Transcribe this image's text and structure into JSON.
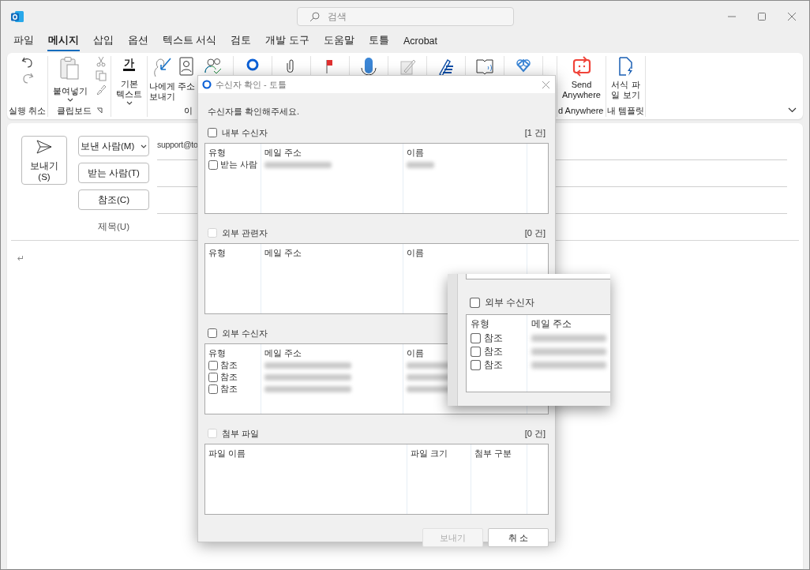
{
  "window": {
    "search_placeholder": "검색"
  },
  "tabs": [
    {
      "label": "파일",
      "selected": false
    },
    {
      "label": "메시지",
      "selected": true
    },
    {
      "label": "삽입",
      "selected": false
    },
    {
      "label": "옵션",
      "selected": false
    },
    {
      "label": "텍스트 서식",
      "selected": false
    },
    {
      "label": "검토",
      "selected": false
    },
    {
      "label": "개발 도구",
      "selected": false
    },
    {
      "label": "도움말",
      "selected": false
    },
    {
      "label": "토틀",
      "selected": false
    },
    {
      "label": "Acrobat",
      "selected": false
    }
  ],
  "ribbon": {
    "groups": [
      {
        "kind": "undo",
        "label": "실행 취소"
      },
      {
        "kind": "clipboard",
        "label": "클립보드",
        "buttons": [
          "붙여넣기"
        ]
      },
      {
        "kind": "text",
        "icon_text": "가",
        "buttons": [
          "기본 텍스트"
        ]
      },
      {
        "kind": "recipients",
        "label": "이",
        "buttons": [
          "나에게 보내기",
          "주소"
        ]
      },
      {
        "kind": "share",
        "label": "d Anywhere",
        "buttons": [
          "Send Anywhere"
        ]
      },
      {
        "kind": "template",
        "label": "내 템플릿",
        "buttons": [
          "서식 파일 보기"
        ]
      }
    ]
  },
  "compose": {
    "send": "보내기(S)",
    "from_button": "보낸 사람(M)",
    "from_value": "support@to",
    "to_button": "받는 사람(T)",
    "cc_button": "참조(C)",
    "subject_label": "제목(U)",
    "body_mark": "↵"
  },
  "dialog": {
    "title": "수신자 확인 - 토틀",
    "prompt": "수신자를 확인해주세요.",
    "sections": [
      {
        "kind": "recipients",
        "label": "내부 수신자",
        "checked": false,
        "disabled": false,
        "count": "[1 건]",
        "columns": [
          "유형",
          "메일 주소",
          "이름"
        ],
        "rows": [
          {
            "type": "받는 사람",
            "checked": false
          }
        ]
      },
      {
        "kind": "recipients",
        "label": "외부 관련자",
        "checked": false,
        "disabled": true,
        "count": "[0 건]",
        "columns": [
          "유형",
          "메일 주소",
          "이름"
        ]
      },
      {
        "kind": "recipients",
        "label": "외부 수신자",
        "checked": false,
        "disabled": false,
        "columns": [
          "유형",
          "메일 주소",
          "이름"
        ],
        "rows": [
          {
            "type": "참조",
            "checked": false
          },
          {
            "type": "참조",
            "checked": false
          },
          {
            "type": "참조",
            "checked": false
          }
        ]
      },
      {
        "kind": "files",
        "label": "첨부 파일",
        "checked": false,
        "disabled": true,
        "count": "[0 건]",
        "columns": [
          "파일 이름",
          "파일 크기",
          "첨부 구분"
        ]
      }
    ],
    "buttons": [
      {
        "label": "보내기",
        "disabled": true
      },
      {
        "label": "취 소",
        "disabled": false
      }
    ]
  },
  "inset": {
    "label": "외부 수신자",
    "checked": false,
    "columns": [
      "유형",
      "메일 주소"
    ],
    "rows": [
      {
        "type": "참조",
        "checked": false
      },
      {
        "type": "참조",
        "checked": false
      },
      {
        "type": "참조",
        "checked": false
      }
    ]
  }
}
